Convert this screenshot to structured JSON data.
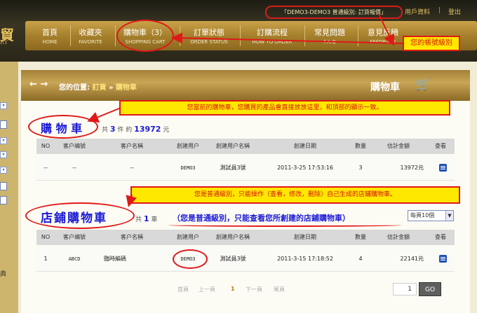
{
  "header": {
    "logo_chars": "貿",
    "logo_sub": "RY",
    "user_badge": "「DEMO3-DEMO3 普通級別: 訂貨報價」",
    "user_info_link": "用戶資料",
    "separator": "|",
    "logout_link": "登出"
  },
  "nav": [
    {
      "cn": "首頁",
      "en": "HOME"
    },
    {
      "cn": "收藏夾",
      "en": "FAVORITE"
    },
    {
      "cn": "購物車（3）",
      "en": "SHOPPING CART"
    },
    {
      "cn": "訂單狀態",
      "en": "ORDER STATUS"
    },
    {
      "cn": "訂購流程",
      "en": "HOW TO ORDER"
    },
    {
      "cn": "常見問題",
      "en": "F.A.Q"
    },
    {
      "cn": "意見反饋",
      "en": "FEEDBACK"
    }
  ],
  "annotations": {
    "level_note": "您的帳號級別",
    "cart_note": "您當前的購物車，您購買的產品會直接放放這里，和頂部的顯示一致。",
    "shop_note_box": "您是普通級別，只能操作（查看，修改，刪除）自己生成的店鋪購物車。",
    "shop_note_blue": "（您是普通級別，只能查看您所創建的店鋪購物車）"
  },
  "breadcrumb": {
    "arrows": "← →",
    "label": "您的位置:",
    "link": "訂貨",
    "sep": "»",
    "current": "購物車"
  },
  "panel_title": "購物車",
  "icons": {
    "cart": "shopping-cart-icon",
    "view": "list-view-icon",
    "back": "arrow-left-icon",
    "forward": "arrow-right-icon"
  },
  "cart": {
    "title": "購 物 車",
    "summary_prefix": "共",
    "count": "3",
    "summary_mid": "件 約",
    "total": "13972",
    "summary_suffix": "元"
  },
  "columns": [
    "NO",
    "客户编號",
    "客户名稱",
    "創建用户",
    "創建用户名稱",
    "創建日期",
    "數量",
    "估計金額",
    "查看"
  ],
  "cart_rows": [
    {
      "no": "--",
      "code": "--",
      "name": "--",
      "user": "DEMO3",
      "user_name": "測試員3號",
      "date": "2011-3-25 17:53:16",
      "qty": "3",
      "amount": "13972元"
    }
  ],
  "shop": {
    "title": "店鋪購物車",
    "summary_prefix": "共",
    "count": "1",
    "summary_suffix": "車",
    "per_page": "每頁10個"
  },
  "shop_rows": [
    {
      "no": "1",
      "code": "ABCD",
      "name": "臨時編碼",
      "user": "DEMO3",
      "user_name": "測試員3號",
      "date": "2011-3-15 17:18:52",
      "qty": "4",
      "amount": "22141元"
    }
  ],
  "pagination": {
    "first": "首頁",
    "prev": "上一頁",
    "current": "1",
    "next": "下一頁",
    "last": "尾頁",
    "input_value": "1",
    "go": "GO"
  },
  "sidebar": {
    "char": "典"
  },
  "colors": {
    "annotation_red": "#e01818",
    "note_yellow": "#ffe800",
    "title_blue": "#1a1ad6",
    "gold": "#c9a556"
  }
}
